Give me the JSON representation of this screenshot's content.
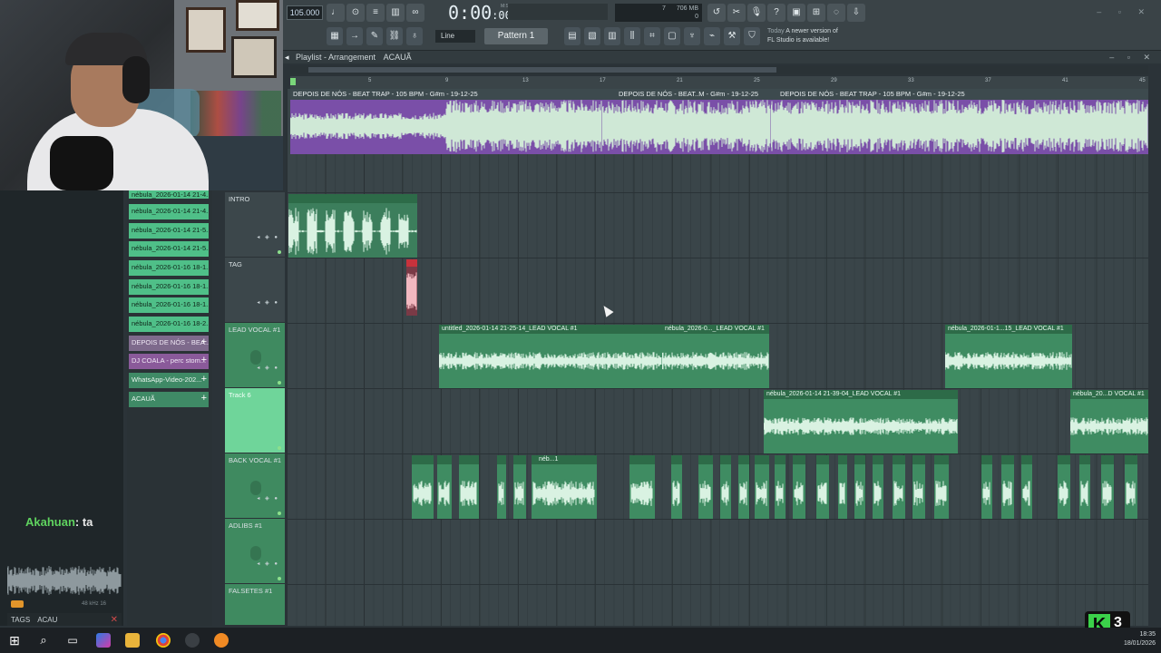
{
  "toolbar": {
    "tempo": "105.000",
    "time": "0:00",
    "time_frac": ":00",
    "time_unit": "M:S:CS",
    "line_mode": "Line",
    "pattern": "Pattern 1",
    "mem": "706 MB",
    "poly_top": "7",
    "poly_bottom": "0",
    "news_today": "Today",
    "news_line1": "A newer version of",
    "news_line2": "FL Studio is available!"
  },
  "playlist": {
    "title": "Playlist - Arrangement",
    "arrangement": "ACAUÃ",
    "timeline_ticks": [
      "5",
      "9",
      "13",
      "17",
      "21",
      "25",
      "29",
      "33",
      "37",
      "41",
      "45"
    ],
    "tracks": [
      {
        "name": "INTRO"
      },
      {
        "name": "TAG"
      },
      {
        "name": "LEAD VOCAL #1"
      },
      {
        "name": "Track 6"
      },
      {
        "name": "BACK VOCAL #1"
      },
      {
        "name": "ADLIBS #1"
      },
      {
        "name": "FALSETES #1"
      }
    ],
    "clips": {
      "master_1": "DEPOIS DE NÓS - BEAT TRAP - 105 BPM - G#m - 19-12-25",
      "master_2": "DEPOIS DE NÓS - BEAT..M - G#m - 19-12-25",
      "master_3": "DEPOIS DE NÓS - BEAT TRAP - 105 BPM - G#m - 19-12-25",
      "lead_1": "untitled_2026-01-14 21-25-14_LEAD VOCAL #1",
      "lead_2": "nébula_2026-0..._LEAD VOCAL #1",
      "lead_3": "nébula_2026-01-1...15_LEAD VOCAL #1",
      "track6_1": "nébula_2026-01-14 21-39-04_LEAD VOCAL #1",
      "track6_2": "nébula_20...D VOCAL #1",
      "back_1": "néb...1"
    }
  },
  "browser": {
    "items": [
      {
        "label": "nébula_2026-01-14 21-4..."
      },
      {
        "label": "nébula_2026-01-14 21-4..."
      },
      {
        "label": "nébula_2026-01-14 21-5..."
      },
      {
        "label": "nébula_2026-01-14 21-5..."
      },
      {
        "label": "nébula_2026-01-16 18-1..."
      },
      {
        "label": "nébula_2026-01-16 18-1..."
      },
      {
        "label": "nébula_2026-01-16 18-1..."
      },
      {
        "label": "nébula_2026-01-16 18-2..."
      },
      {
        "label": "DEPOIS DE NÓS - BEA..."
      },
      {
        "label": "DJ COALA - perc stom..."
      },
      {
        "label": "WhatsApp-Video-202..."
      },
      {
        "label": "ACAUÃ"
      }
    ],
    "tags_label": "TAGS",
    "tags_value": "ACAU",
    "sample_info": "48 kHz 16"
  },
  "chat": {
    "user": "Akahuan",
    "message": ": ta"
  },
  "taskbar": {
    "time": "18:35",
    "date": "18/01/2026"
  },
  "overlay": {
    "logo_letter": "K",
    "logo_number": "3"
  }
}
